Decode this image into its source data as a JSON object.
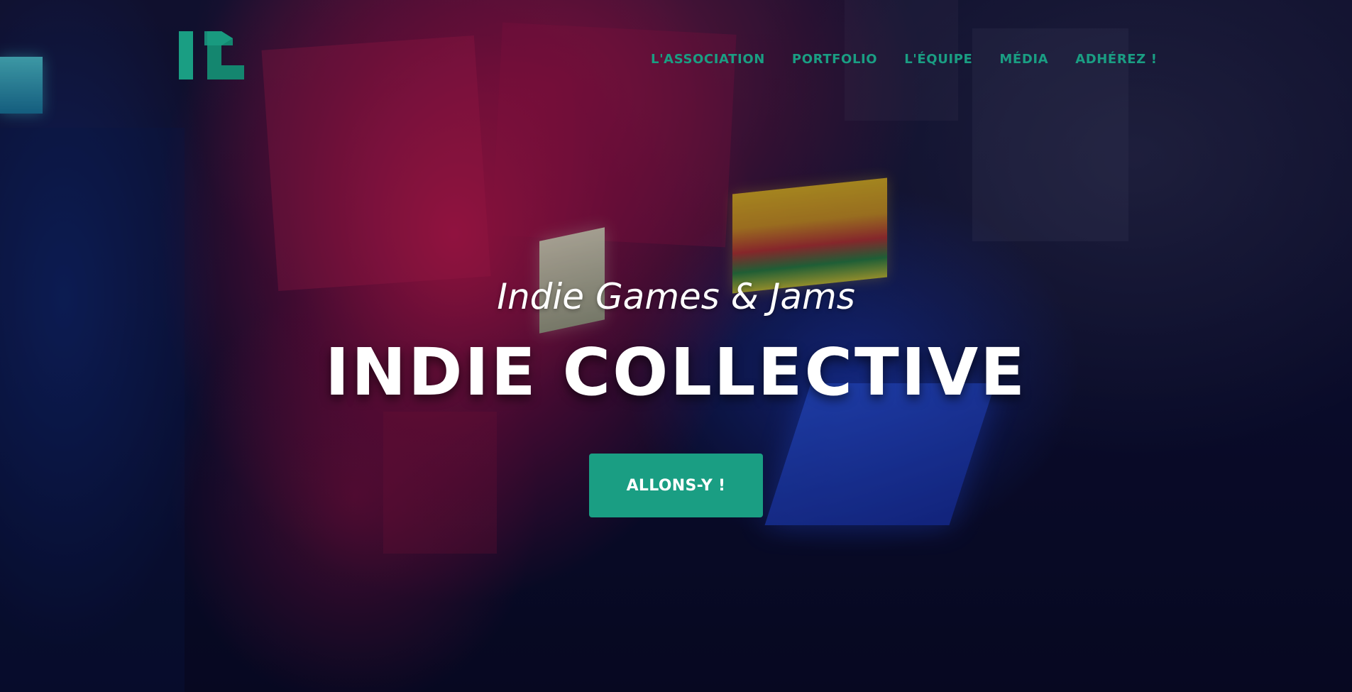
{
  "brand": {
    "logo_label": "IC",
    "accent_color": "#1a9e83",
    "logo_icon": "ic-monogram-icon"
  },
  "nav": {
    "items": [
      {
        "label": "L'ASSOCIATION"
      },
      {
        "label": "PORTFOLIO"
      },
      {
        "label": "L'ÉQUIPE"
      },
      {
        "label": "MÉDIA"
      },
      {
        "label": "ADHÉREZ !"
      }
    ]
  },
  "hero": {
    "subtitle": "Indie Games & Jams",
    "title": "INDIE COLLECTIVE",
    "cta_label": "ALLONS-Y !",
    "background": "arcade-room-photo"
  }
}
